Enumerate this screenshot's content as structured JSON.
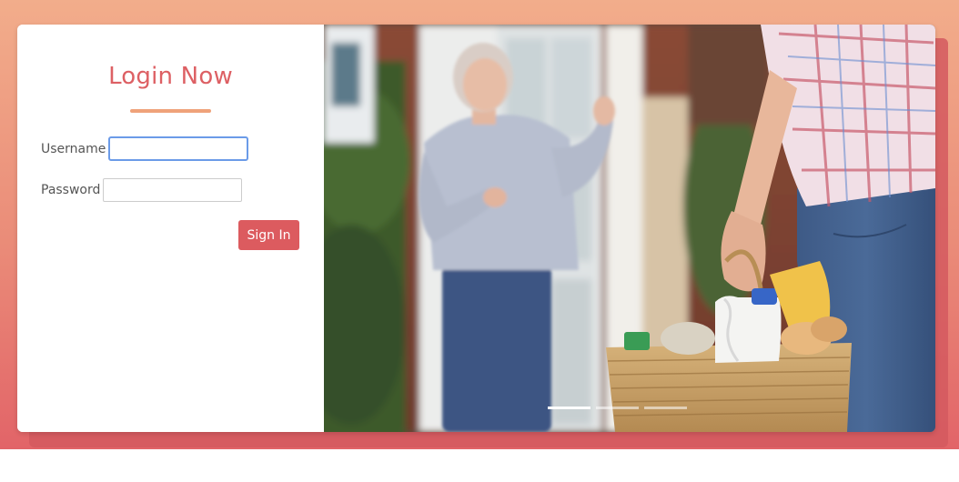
{
  "login": {
    "title": "Login Now",
    "username_label": "Username",
    "username_value": "",
    "password_label": "Password",
    "password_value": "",
    "signin_label": "Sign In"
  },
  "carousel": {
    "slide_count": 3,
    "active_index": 0,
    "image_description_icon": "photo-neighbor-delivering-groceries"
  },
  "colors": {
    "accent": "#dd6064",
    "underline": "#efa27a",
    "focus": "#6b9be8",
    "bg_top": "#f2ad8b",
    "bg_bottom": "#e26468"
  }
}
